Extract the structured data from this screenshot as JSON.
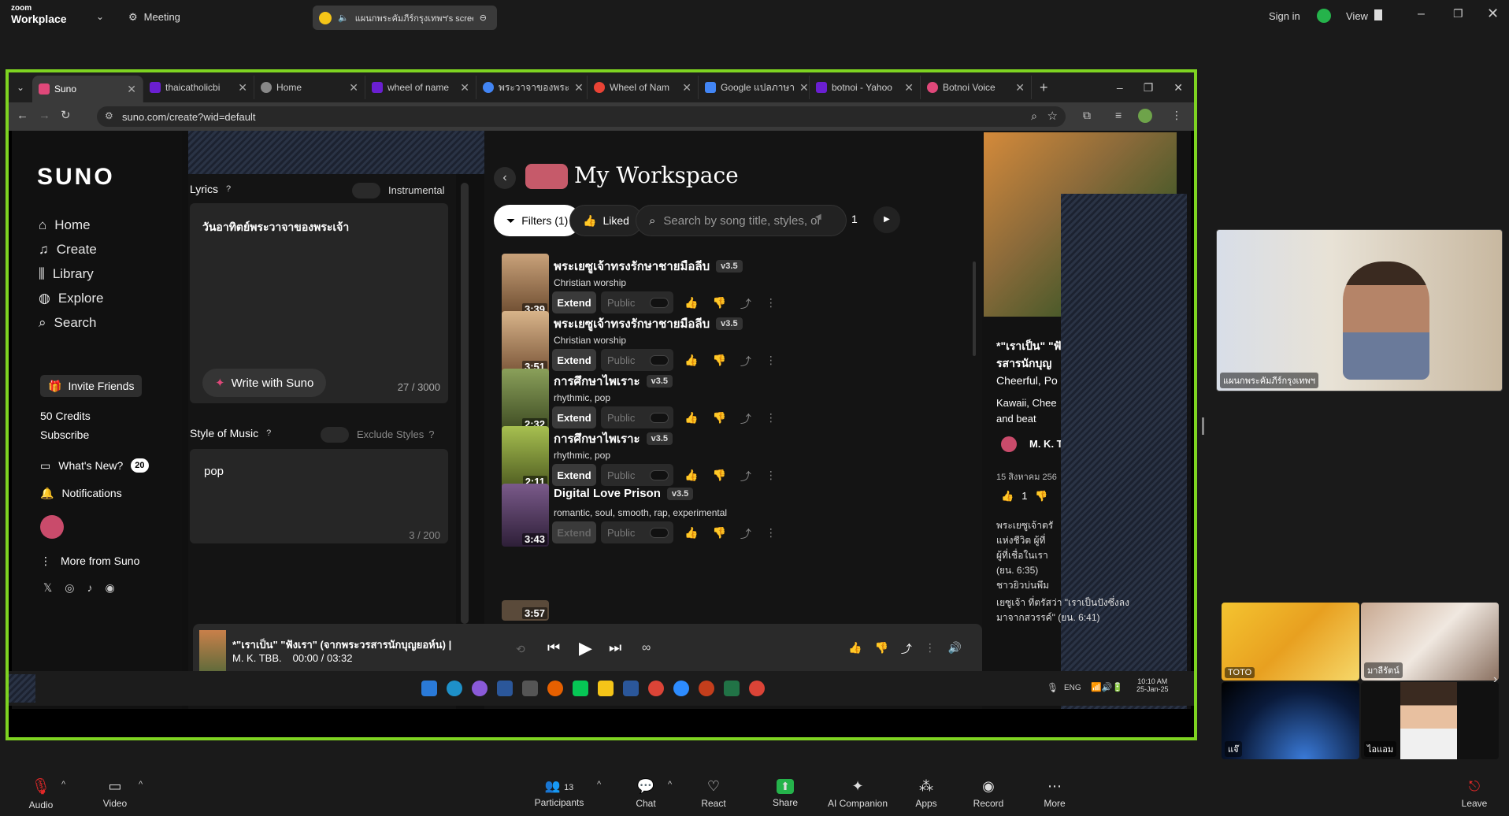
{
  "zoom": {
    "logo_line1": "zoom",
    "logo_line2": "Workplace",
    "meeting_label": "Meeting",
    "share_banner": "แผนกพระคัมภีร์กรุงเทพฯ's scree",
    "sign_in": "Sign in",
    "view": "View",
    "toolbar": [
      {
        "label": "Audio",
        "icon": "mic-muted-icon"
      },
      {
        "label": "Video",
        "icon": "video-icon"
      },
      {
        "label": "Participants",
        "icon": "participants-icon",
        "count": "13"
      },
      {
        "label": "Chat",
        "icon": "chat-icon"
      },
      {
        "label": "React",
        "icon": "heart-icon"
      },
      {
        "label": "Share",
        "icon": "share-screen-icon"
      },
      {
        "label": "AI Companion",
        "icon": "sparkle-icon"
      },
      {
        "label": "Apps",
        "icon": "apps-icon"
      },
      {
        "label": "Record",
        "icon": "record-icon"
      },
      {
        "label": "More",
        "icon": "more-icon"
      },
      {
        "label": "Leave",
        "icon": "leave-icon"
      }
    ],
    "speaker_name": "แผนกพระคัมภีร์กรุงเทพฯ",
    "gallery": [
      {
        "name": "TOTO"
      },
      {
        "name": "มาลีรัตน์"
      },
      {
        "name": "แจ๊"
      },
      {
        "name": "ไอแอม"
      }
    ]
  },
  "browser": {
    "tabs": [
      {
        "title": "Suno",
        "color": "#e0487a"
      },
      {
        "title": "thaicatholicbi",
        "color": "#6a1fd1"
      },
      {
        "title": "Home",
        "color": "#888888"
      },
      {
        "title": "wheel of name",
        "color": "#6a1fd1"
      },
      {
        "title": "พระวาจาของพระ",
        "color": "#4285f4"
      },
      {
        "title": "Wheel of Nam",
        "color": "#ea4335"
      },
      {
        "title": "Google แปลภาษา",
        "color": "#4285f4"
      },
      {
        "title": "botnoi - Yahoo",
        "color": "#6a1fd1"
      },
      {
        "title": "Botnoi Voice",
        "color": "#e0487a"
      }
    ],
    "url": "suno.com/create?wid=default"
  },
  "suno": {
    "brand": "SUNO",
    "nav": [
      {
        "label": "Home",
        "icon": "home-icon"
      },
      {
        "label": "Create",
        "icon": "music-note-icon"
      },
      {
        "label": "Library",
        "icon": "library-icon"
      },
      {
        "label": "Explore",
        "icon": "compass-icon"
      },
      {
        "label": "Search",
        "icon": "search-icon"
      }
    ],
    "invite": "Invite Friends",
    "credits": "50 Credits",
    "subscribe": "Subscribe",
    "whats_new": "What's New?",
    "whats_new_count": "20",
    "notifications": "Notifications",
    "more_from": "More from Suno",
    "lyrics_label": "Lyrics",
    "instrumental": "Instrumental",
    "lyrics_text": "วันอาทิตย์พระวาจาของพระเจ้า",
    "write_with": "Write with Suno",
    "lyrics_count": "27 / 3000",
    "style_label": "Style of Music",
    "exclude_styles": "Exclude Styles",
    "style_text": "pop",
    "style_count": "3 / 200",
    "workspace_title": "My Workspace",
    "filters": "Filters (1)",
    "liked": "Liked",
    "search_placeholder": "Search by song title, styles, or",
    "page": "1",
    "extend": "Extend",
    "public": "Public",
    "songs": [
      {
        "title": "พระเยซูเจ้าทรงรักษาชายมือลีบ",
        "version": "v3.5",
        "style": "Christian worship",
        "duration": "3:39",
        "liked": true
      },
      {
        "title": "พระเยซูเจ้าทรงรักษาชายมือลีบ",
        "version": "v3.5",
        "style": "Christian worship",
        "duration": "3:51",
        "liked": false
      },
      {
        "title": "การศึกษาไพเราะ",
        "version": "v3.5",
        "style": "rhythmic, pop",
        "duration": "2:32",
        "liked": false
      },
      {
        "title": "การศึกษาไพเราะ",
        "version": "v3.5",
        "style": "rhythmic, pop",
        "duration": "2:11",
        "liked": false
      },
      {
        "title": "Digital Love Prison",
        "version": "v3.5",
        "style": "romantic, soul, smooth, rap, experimental",
        "duration": "3:43",
        "liked": false
      },
      {
        "title": "",
        "version": "",
        "style": "",
        "duration": "3:57",
        "liked": false
      }
    ],
    "player": {
      "title": "*\"เราเป็น\" \"ฟังเรา\" (จากพระวรสารนักบุญยอห์น) |",
      "artist": "M. K. TBB.",
      "time": "00:00 / 03:32"
    },
    "detail": {
      "title_line1": "*\"เราเป็น\" \"ฟั",
      "title_line2": "รสารนักบุญ",
      "title_line3": "Cheerful, Po",
      "tags": "Kawaii, Chee",
      "tags2": "and beat",
      "author": "M. K. T",
      "date": "15 สิงหาคม 256",
      "likes": "1",
      "desc1": "พระเยซูเจ้าตรั",
      "desc2": "แห่งชีวิต ผู้ที่",
      "desc3": "ผู้ที่เชื่อในเรา",
      "desc4": "(ยน. 6:35)",
      "desc5": "ชาวยิวบ่นพึม",
      "desc6": "เยซูเจ้า ที่ตรัสว่า \"เราเป็นปังซึ่งลง",
      "desc7": "มาจากสวรรค์\" (ยน. 6:41)"
    }
  },
  "taskbar": {
    "lang": "ENG",
    "time": "10:10 AM",
    "date": "25-Jan-25"
  }
}
